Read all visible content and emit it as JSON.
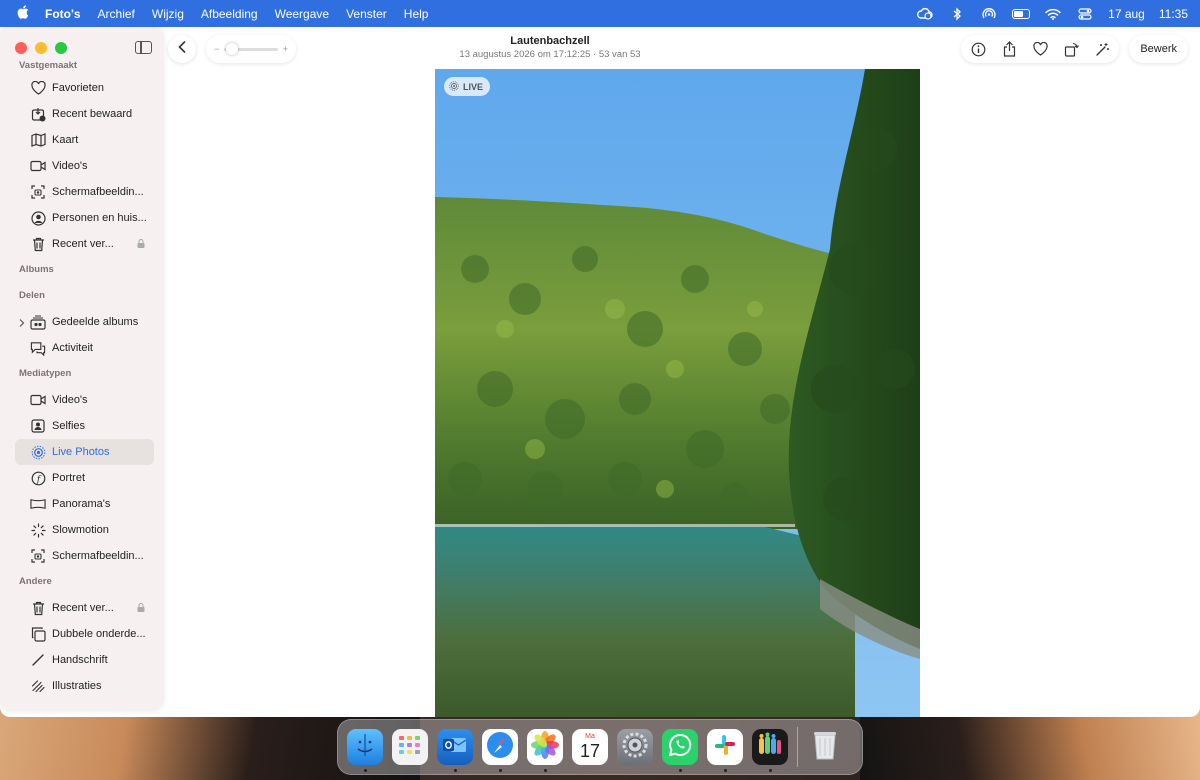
{
  "menubar": {
    "app_name": "Foto's",
    "items": [
      "Archief",
      "Wijzig",
      "Afbeelding",
      "Weergave",
      "Venster",
      "Help"
    ],
    "date": "17 aug",
    "time": "11:35",
    "battery_level": 0.6
  },
  "sidebar": {
    "partial_item": "Vastgemaakt",
    "pinned": [
      {
        "label": "Favorieten",
        "icon": "heart-icon"
      },
      {
        "label": "Recent bewaard",
        "icon": "recently-saved-icon"
      },
      {
        "label": "Kaart",
        "icon": "map-icon"
      },
      {
        "label": "Video's",
        "icon": "video-icon"
      },
      {
        "label": "Schermafbeeldin...",
        "icon": "screenshot-icon"
      },
      {
        "label": "Personen en huis...",
        "icon": "person-icon"
      },
      {
        "label": "Recent ver...",
        "icon": "trash-icon",
        "locked": true
      }
    ],
    "albums_header": "Albums",
    "sharing_header": "Delen",
    "sharing": [
      {
        "label": "Gedeelde albums",
        "icon": "shared-albums-icon"
      },
      {
        "label": "Activiteit",
        "icon": "activity-icon"
      }
    ],
    "media_header": "Mediatypen",
    "media": [
      {
        "label": "Video's",
        "icon": "video-icon"
      },
      {
        "label": "Selfies",
        "icon": "selfie-icon"
      },
      {
        "label": "Live Photos",
        "icon": "live-photo-icon",
        "selected": true
      },
      {
        "label": "Portret",
        "icon": "portrait-icon"
      },
      {
        "label": "Panorama's",
        "icon": "panorama-icon"
      },
      {
        "label": "Slowmotion",
        "icon": "slowmo-icon"
      },
      {
        "label": "Schermafbeeldin...",
        "icon": "screenshot-icon"
      }
    ],
    "other_header": "Andere",
    "other": [
      {
        "label": "Recent ver...",
        "icon": "trash-icon",
        "locked": true
      },
      {
        "label": "Dubbele onderde...",
        "icon": "duplicates-icon"
      },
      {
        "label": "Handschrift",
        "icon": "handwriting-icon"
      },
      {
        "label": "Illustraties",
        "icon": "illustrations-icon"
      }
    ]
  },
  "viewer": {
    "title": "Lautenbachzell",
    "subtitle": "13 augustus 2026 om 17:12:25  ·  53 van 53",
    "zoom_minus": "−",
    "zoom_plus": "+",
    "edit_label": "Bewerk",
    "live_badge": "LIVE"
  },
  "dock": {
    "apps": [
      {
        "name": "Finder",
        "icon": "finder-icon",
        "running": true
      },
      {
        "name": "Launchpad",
        "icon": "launchpad-icon",
        "running": false
      },
      {
        "name": "Outlook",
        "icon": "outlook-icon",
        "running": true
      },
      {
        "name": "Safari",
        "icon": "safari-icon",
        "running": true
      },
      {
        "name": "Foto's",
        "icon": "photos-icon",
        "running": true
      },
      {
        "name": "Agenda",
        "icon": "calendar-icon",
        "running": false,
        "month": "Ma",
        "day": "17"
      },
      {
        "name": "Systeeminstellingen",
        "icon": "settings-icon",
        "running": false
      },
      {
        "name": "WhatsApp",
        "icon": "whatsapp-icon",
        "running": true
      },
      {
        "name": "Slack",
        "icon": "slack-icon",
        "running": true
      },
      {
        "name": "Teams",
        "icon": "teams-icon",
        "running": true
      },
      {
        "name": "Prullenmand",
        "icon": "trash-icon",
        "running": false
      }
    ]
  },
  "colors": {
    "menubar": "#2f6fe0",
    "accent": "#2f6fe0",
    "sidebar_bg": "#f6f1f0"
  }
}
